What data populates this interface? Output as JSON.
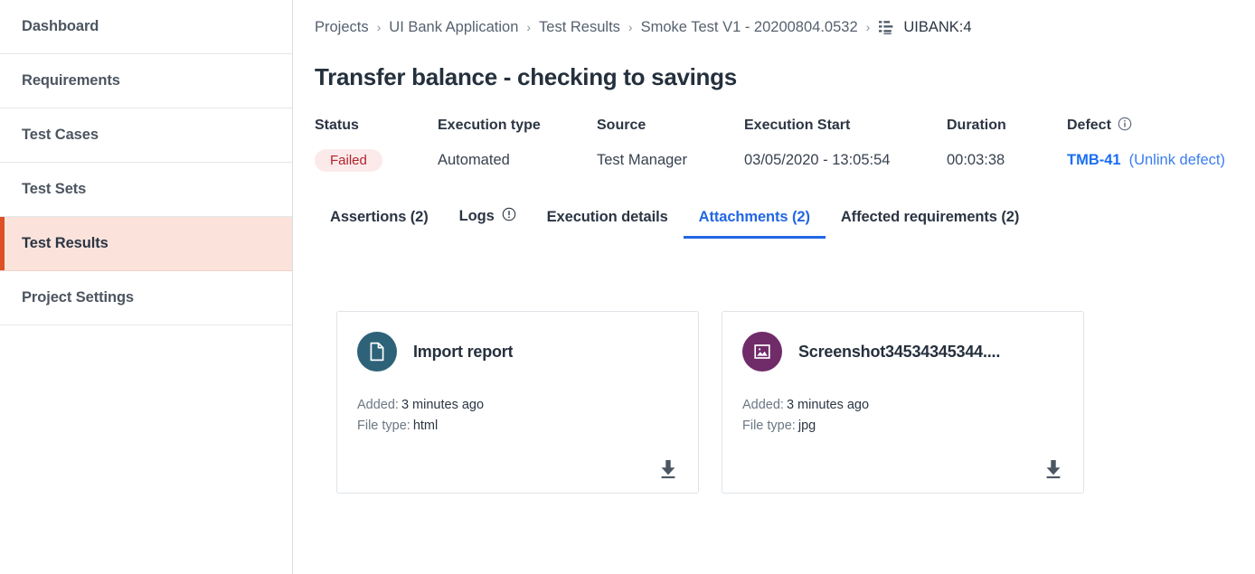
{
  "sidebar": {
    "items": [
      {
        "label": "Dashboard",
        "active": false
      },
      {
        "label": "Requirements",
        "active": false
      },
      {
        "label": "Test Cases",
        "active": false
      },
      {
        "label": "Test Sets",
        "active": false
      },
      {
        "label": "Test Results",
        "active": true
      },
      {
        "label": "Project Settings",
        "active": false
      }
    ],
    "active_bg": "#fbe3dc",
    "active_accent": "#dd4f25"
  },
  "breadcrumb": {
    "sep": "›",
    "items": [
      {
        "label": "Projects"
      },
      {
        "label": "UI Bank Application"
      },
      {
        "label": "Test Results"
      },
      {
        "label": "Smoke Test V1 - 20200804.0532"
      },
      {
        "label": "UIBANK:4",
        "icon": "test-case-list-icon"
      }
    ]
  },
  "page": {
    "title": "Transfer balance - checking to savings"
  },
  "meta": {
    "status": {
      "label": "Status",
      "value": "Failed",
      "badge_bg": "#fceaea",
      "badge_color": "#b2222c"
    },
    "execution_type": {
      "label": "Execution type",
      "value": "Automated"
    },
    "source": {
      "label": "Source",
      "value": "Test Manager"
    },
    "execution_start": {
      "label": "Execution Start",
      "value": "03/05/2020 - 13:05:54"
    },
    "duration": {
      "label": "Duration",
      "value": "00:03:38"
    },
    "defect": {
      "label": "Defect",
      "info_icon": "info-circle-icon",
      "id": "TMB-41",
      "unlink_label": "(Unlink defect)",
      "link_color": "#1b6ef3"
    }
  },
  "tabs": {
    "accent": "#2266e3",
    "items": [
      {
        "label": "Assertions (2)",
        "active": false,
        "icon": null
      },
      {
        "label": "Logs",
        "active": false,
        "icon": "warning-circle-icon"
      },
      {
        "label": "Execution details",
        "active": false,
        "icon": null
      },
      {
        "label": "Attachments (2)",
        "active": true,
        "icon": null
      },
      {
        "label": "Affected requirements (2)",
        "active": false,
        "icon": null
      }
    ]
  },
  "attachments": {
    "added_label": "Added:",
    "filetype_label": "File type:",
    "download_icon": "download-icon",
    "items": [
      {
        "title": "Import report",
        "icon": "document-icon",
        "icon_bg": "#2e6279",
        "added": "3 minutes ago",
        "file_type": "html"
      },
      {
        "title": "Screenshot34534345344....",
        "icon": "image-icon",
        "icon_bg": "#702b69",
        "added": "3 minutes ago",
        "file_type": "jpg"
      }
    ]
  }
}
